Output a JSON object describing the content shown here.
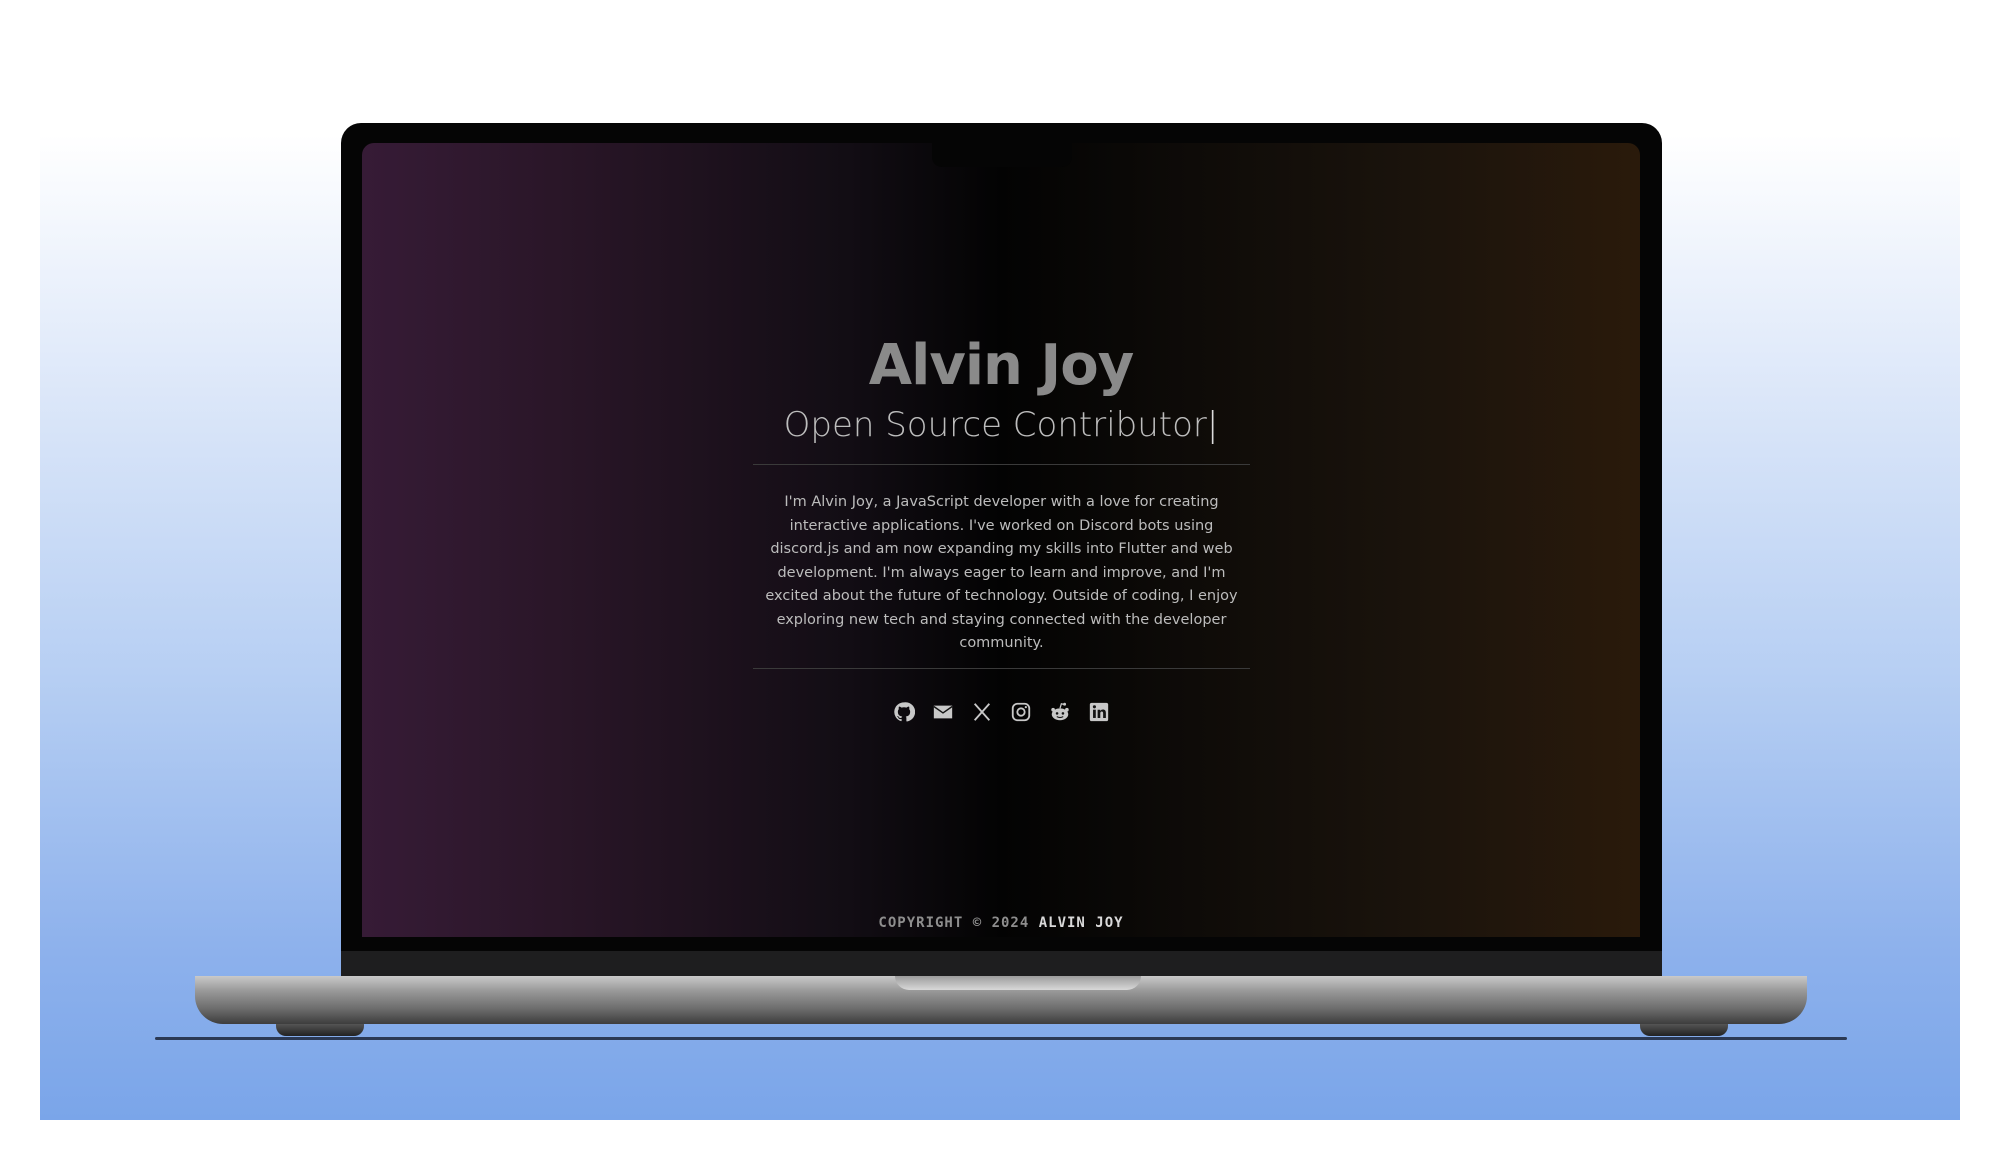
{
  "profile": {
    "name": "Alvin Joy",
    "role": "Open Source Contributor",
    "cursor": "|",
    "bio": "I'm Alvin Joy, a JavaScript developer with a love for creating interactive applications. I've worked on Discord bots using discord.js and am now expanding my skills into Flutter and web development. I'm always eager to learn and improve, and I'm excited about the future of technology. Outside of coding, I enjoy exploring new tech and staying connected with the developer community."
  },
  "socials": [
    {
      "icon": "github-icon"
    },
    {
      "icon": "email-icon"
    },
    {
      "icon": "x-icon"
    },
    {
      "icon": "instagram-icon"
    },
    {
      "icon": "reddit-icon"
    },
    {
      "icon": "linkedin-icon"
    }
  ],
  "footer": {
    "prefix": "COPYRIGHT © 2024",
    "owner": "ALVIN JOY"
  },
  "colors": {
    "icon": "#c8c8c8",
    "background_left": "#361b36",
    "background_right": "#2a1a0b"
  }
}
